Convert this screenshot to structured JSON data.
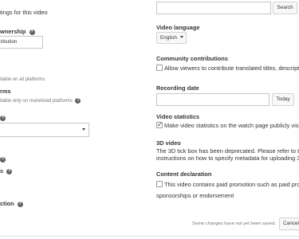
{
  "left": {
    "settings_text": "tings for this video",
    "ownership_label": "wnership",
    "contribution_value": "tribution",
    "available_all_text": "ilable on all platforms",
    "rms_label": "rms",
    "available_monetised_text": "ilable only on monetised platforms",
    "s_label": "s",
    "ction_label": "ction"
  },
  "right": {
    "search_button": "Search",
    "video_language_label": "Video language",
    "language_value": "English",
    "community_label": "Community contributions",
    "community_checkbox_label": "Allow viewers to contribute translated titles, descriptions",
    "recording_date_label": "Recording date",
    "today_button": "Today",
    "video_statistics_label": "Video statistics",
    "statistics_checkbox_label": "Make video statistics on the watch page publicly visible",
    "video_3d_label": "3D video",
    "video_3d_line1": "The 3D tick box has been deprecated. Please refer to this",
    "video_3d_link": "H",
    "video_3d_line2": "instructions on how to specify metadata for uploading 3D fi",
    "content_declaration_label": "Content declaration",
    "paid_promotion_line1": "This video contains paid promotion such as paid produ",
    "paid_promotion_line2": "sponsorships or endorsement"
  },
  "footer": {
    "unsaved_text": "Some changes have not yet been saved.",
    "cancel_button": "Cancel"
  },
  "icons": {
    "help": "?",
    "check": "✓"
  },
  "colors": {
    "link": "#167ac6",
    "text": "#333333",
    "muted": "#767676"
  }
}
